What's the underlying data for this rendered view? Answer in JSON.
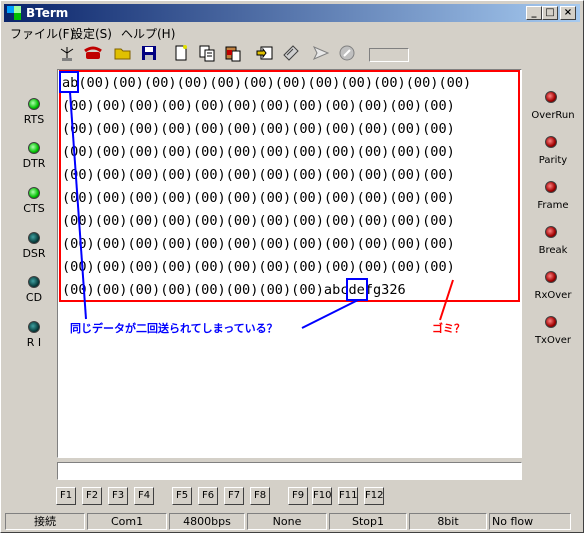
{
  "window": {
    "title": "BTerm",
    "minimize": "_",
    "maximize": "□",
    "close": "×"
  },
  "menu": [
    {
      "label": "ファイル(F)"
    },
    {
      "label": "設定(S)"
    },
    {
      "label": "ヘルプ(H)"
    }
  ],
  "toolbar": [
    "antenna-icon",
    "phone-icon",
    "open-folder-icon",
    "save-icon",
    "new-file-icon",
    "copy-icon",
    "paste-icon",
    "receive-file-icon",
    "send-file-icon",
    "send-arrow-icon",
    "stop-icon"
  ],
  "terminal": {
    "lines": [
      "ab(00)(00)(00)(00)(00)(00)(00)(00)(00)(00)(00)(00)",
      "(00)(00)(00)(00)(00)(00)(00)(00)(00)(00)(00)(00)",
      "(00)(00)(00)(00)(00)(00)(00)(00)(00)(00)(00)(00)",
      "(00)(00)(00)(00)(00)(00)(00)(00)(00)(00)(00)(00)",
      "(00)(00)(00)(00)(00)(00)(00)(00)(00)(00)(00)(00)",
      "(00)(00)(00)(00)(00)(00)(00)(00)(00)(00)(00)(00)",
      "(00)(00)(00)(00)(00)(00)(00)(00)(00)(00)(00)(00)",
      "(00)(00)(00)(00)(00)(00)(00)(00)(00)(00)(00)(00)",
      "(00)(00)(00)(00)(00)(00)(00)(00)(00)(00)(00)(00)",
      "(00)(00)(00)(00)(00)(00)(00)(00)abcdefg326"
    ],
    "annotation_left": "同じデータが二回送られてしまっている？",
    "annotation_right": "ゴミ？"
  },
  "input": {
    "value": ""
  },
  "left_leds": [
    {
      "label": "RTS",
      "state": "on"
    },
    {
      "label": "DTR",
      "state": "on"
    },
    {
      "label": "CTS",
      "state": "on"
    },
    {
      "label": "DSR",
      "state": "off"
    },
    {
      "label": "CD",
      "state": "off"
    },
    {
      "label": "R I",
      "state": "off"
    }
  ],
  "right_leds": [
    {
      "label": "OverRun"
    },
    {
      "label": "Parity"
    },
    {
      "label": "Frame"
    },
    {
      "label": "Break"
    },
    {
      "label": "RxOver"
    },
    {
      "label": "TxOver"
    }
  ],
  "fkeys": [
    "F1",
    "F2",
    "F3",
    "F4",
    "F5",
    "F6",
    "F7",
    "F8",
    "F9",
    "F10",
    "F11",
    "F12"
  ],
  "status": [
    "接続",
    "Com1",
    "4800bps",
    "None",
    "Stop1",
    "8bit",
    "No flow"
  ],
  "colors": {
    "led_on": "#00c000",
    "led_off": "#003030",
    "led_red": "#a00000",
    "annot_red": "#ff0000",
    "annot_blue": "#0000ff"
  }
}
